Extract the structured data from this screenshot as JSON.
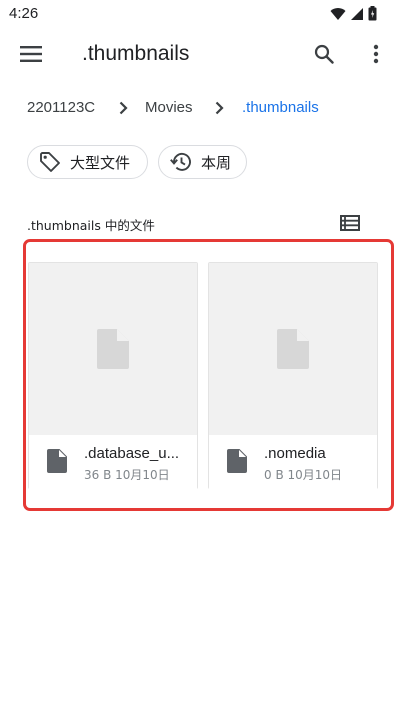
{
  "status_bar": {
    "time": "4:26",
    "icons": [
      "wifi-icon",
      "signal-icon",
      "battery-icon"
    ]
  },
  "app_bar": {
    "title": ".thumbnails",
    "icons": [
      "menu-icon",
      "search-icon",
      "more-vert-icon"
    ]
  },
  "breadcrumb": {
    "items": [
      "2201123C",
      "Movies",
      ".thumbnails"
    ],
    "active_color": "#1a73e8"
  },
  "chips": [
    {
      "label": "大型文件",
      "icon": "tag-icon"
    },
    {
      "label": "本周",
      "icon": "history-icon"
    }
  ],
  "section": {
    "title": ".thumbnails 中的文件",
    "view_icon": "list-view-icon"
  },
  "files": [
    {
      "name": ".database_uuid",
      "display_name": ".database_u...",
      "size": "36 B",
      "date": "10月10日",
      "meta": "36 B 10月10日",
      "icon": "file-icon"
    },
    {
      "name": ".nomedia",
      "display_name": ".nomedia",
      "size": "0 B",
      "date": "10月10日",
      "meta": "0 B 10月10日",
      "icon": "file-icon"
    }
  ],
  "colors": {
    "highlight_border": "#e53935",
    "thumb_bg": "#f1f1f1",
    "icon_gray": "#5f6368"
  }
}
